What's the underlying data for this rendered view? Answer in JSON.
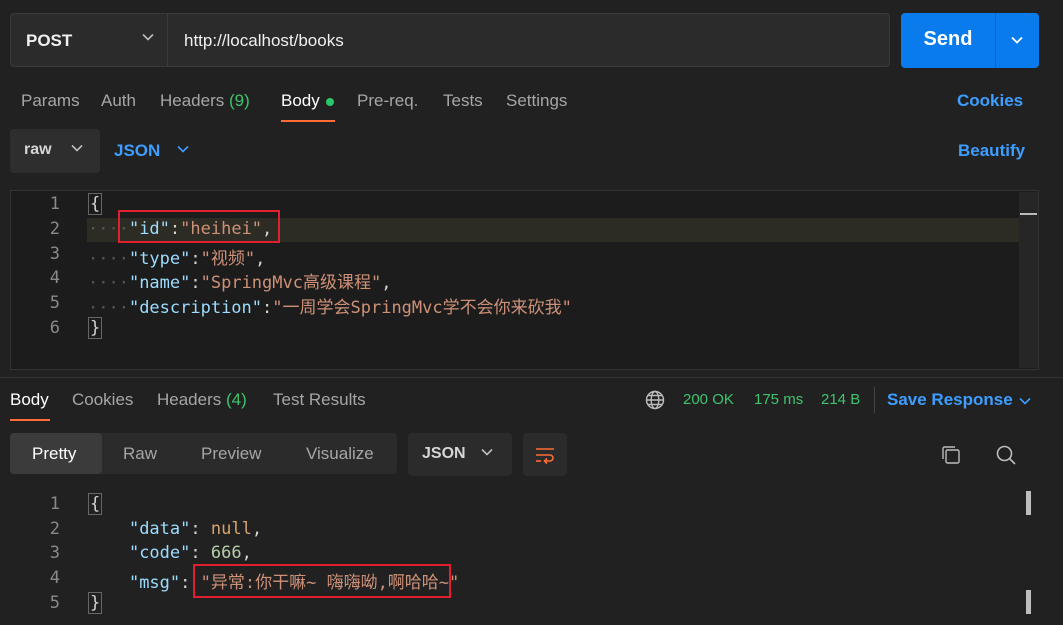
{
  "request": {
    "method": "POST",
    "url": "http://localhost/books",
    "send_label": "Send"
  },
  "request_tabs": {
    "params": "Params",
    "auth": "Auth",
    "headers": "Headers",
    "headers_count": "(9)",
    "body": "Body",
    "prereq": "Pre-req.",
    "tests": "Tests",
    "settings": "Settings",
    "cookies": "Cookies"
  },
  "body_options": {
    "mode": "raw",
    "language": "JSON",
    "beautify": "Beautify"
  },
  "request_body": {
    "line_numbers": [
      "1",
      "2",
      "3",
      "4",
      "5",
      "6"
    ],
    "open_brace": "{",
    "close_brace": "}",
    "id_key": "\"id\"",
    "id_value": "\"heihei\"",
    "type_key": "\"type\"",
    "type_value": "\"视频\"",
    "name_key": "\"name\"",
    "name_value": "\"SpringMvc高级课程\"",
    "description_key": "\"description\"",
    "description_value": "\"一周学会SpringMvc学不会你来砍我\""
  },
  "response_tabs": {
    "body": "Body",
    "cookies": "Cookies",
    "headers": "Headers",
    "headers_count": "(4)",
    "test_results": "Test Results",
    "status": "200 OK",
    "time": "175 ms",
    "size": "214 B",
    "save_response": "Save Response"
  },
  "response_view": {
    "pretty": "Pretty",
    "raw": "Raw",
    "preview": "Preview",
    "visualize": "Visualize",
    "language": "JSON"
  },
  "response_body": {
    "line_numbers": [
      "1",
      "2",
      "3",
      "4",
      "5"
    ],
    "open_brace": "{",
    "close_brace": "}",
    "data_key": "\"data\"",
    "data_value": "null",
    "code_key": "\"code\"",
    "code_value": "666",
    "msg_key": "\"msg\"",
    "msg_value": "\"异常:你干嘛~ 嗨嗨呦,啊哈哈~\""
  },
  "colors": {
    "accent_orange": "#ff6c37",
    "link_blue": "#3d9eff",
    "send_blue": "#097bed",
    "status_green": "#3ec46d",
    "highlight_red": "#e0202e"
  },
  "icons": [
    "chevron-down-icon",
    "globe-icon",
    "wrap-lines-icon",
    "copy-icon",
    "search-icon"
  ]
}
